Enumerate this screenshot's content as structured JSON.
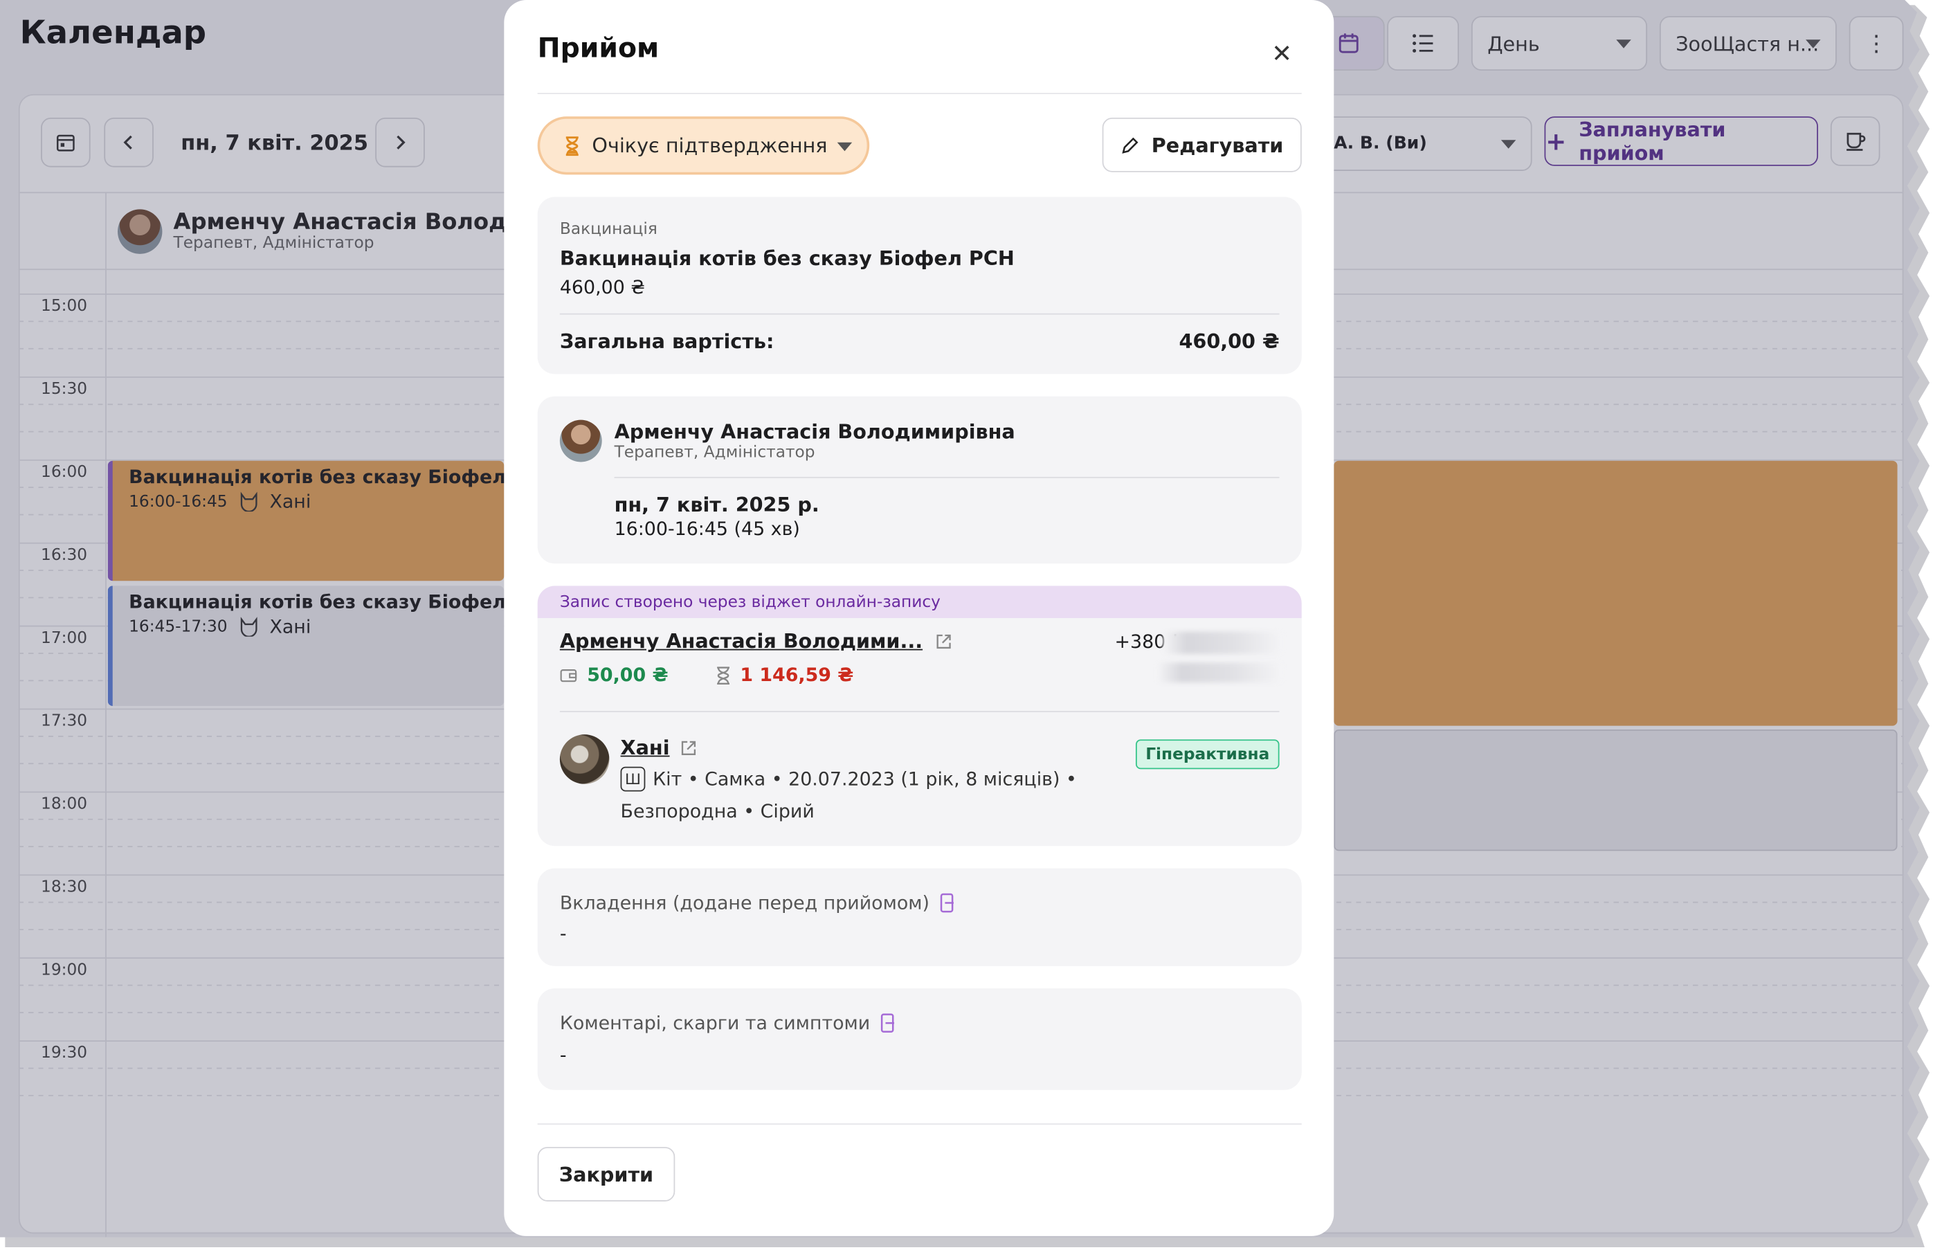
{
  "app": {
    "title": "Календар"
  },
  "top_controls": {
    "view_select": "День",
    "clinic_select": "ЗооЩастя н..."
  },
  "toolbar": {
    "date": "пн, 7 квіт. 2025 р.",
    "doctor_filter": "А. В. (Ви)",
    "schedule_button": "Запланувати прийом"
  },
  "column_doctor": {
    "name": "Арменчу Анастасія Володим",
    "role": "Терапевт, Адміністатор"
  },
  "times": [
    "15:00",
    "15:30",
    "16:00",
    "16:30",
    "17:00",
    "17:30",
    "18:00",
    "18:30",
    "19:00",
    "19:30"
  ],
  "events": [
    {
      "title": "Вакцинація котів без сказу Біофел РС",
      "time": "16:00-16:45",
      "pet": "Хані",
      "color": "#e3a459",
      "stripe": "#8a5cc2"
    },
    {
      "title": "Вакцинація котів без сказу Біофел РС",
      "time": "16:45-17:30",
      "pet": "Хані",
      "color": "#ececef",
      "stripe": "#5a7fd8"
    }
  ],
  "modal": {
    "title": "Прийом",
    "status": "Очікує підтвердження",
    "edit_button": "Редагувати",
    "service": {
      "category": "Вакцинація",
      "name": "Вакцинація котів без сказу Біофел РСН",
      "price": "460,00 ₴"
    },
    "total": {
      "label": "Загальна вартість:",
      "value": "460,00 ₴"
    },
    "doctor": {
      "name": "Арменчу Анастасія Володимирівна",
      "role": "Терапевт, Адміністатор",
      "date": "пн, 7 квіт. 2025 р.",
      "time": "16:00-16:45 (45 хв)"
    },
    "client": {
      "banner": "Запис створено через віджет онлайн-запису",
      "name": "Арменчу Анастасія Володими...",
      "phone": "+380 !",
      "balance": "50,00 ₴",
      "debt": "1 146,59 ₴",
      "balance_color": "#1d8a4e",
      "debt_color": "#cc2b1d"
    },
    "pet": {
      "name": "Хані",
      "tag": "Гіперактивна",
      "details_line1": "Кіт • Самка • 20.07.2023 (1 рік, 8 місяців) •",
      "details_line2": "Безпородна • Сірий"
    },
    "attachments": {
      "label": "Вкладення (додане перед прийомом)",
      "value": "-"
    },
    "comments": {
      "label": "Коментарі, скарги та симптоми",
      "value": "-"
    },
    "close_button": "Закрити"
  }
}
